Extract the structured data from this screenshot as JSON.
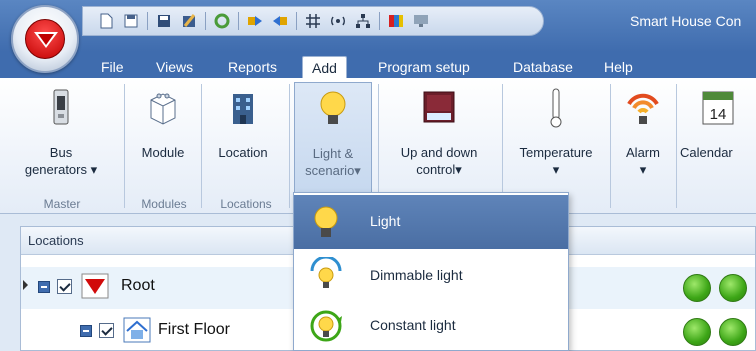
{
  "window": {
    "title": "Smart House Con",
    "quick_access_icons": [
      "new-icon",
      "save-icon",
      "save-as-icon",
      "edit-icon",
      "refresh-icon",
      "import-icon",
      "export-icon",
      "network-icon",
      "wireless-icon",
      "topology-icon",
      "palette-icon",
      "monitor-icon"
    ]
  },
  "menu": {
    "tabs": [
      "File",
      "Views",
      "Reports",
      "Add",
      "Program setup",
      "Database",
      "Help"
    ],
    "active": "Add"
  },
  "ribbon": {
    "buttons": [
      {
        "label_line1": "Bus",
        "label_line2": "generators",
        "has_dropdown": true,
        "icon": "bus-generator-icon"
      },
      {
        "label_line1": "Module",
        "label_line2": "",
        "has_dropdown": false,
        "icon": "module-icon"
      },
      {
        "label_line1": "Location",
        "label_line2": "",
        "has_dropdown": false,
        "icon": "building-icon"
      },
      {
        "label_line1": "Light &",
        "label_line2": "scenario",
        "has_dropdown": true,
        "icon": "light-bulb-icon"
      },
      {
        "label_line1": "Up and down",
        "label_line2": "control",
        "has_dropdown": true,
        "icon": "blind-icon"
      },
      {
        "label_line1": "Temperature",
        "label_line2": "",
        "has_dropdown": true,
        "icon": "thermometer-icon"
      },
      {
        "label_line1": "Alarm",
        "label_line2": "",
        "has_dropdown": true,
        "icon": "alarm-icon"
      },
      {
        "label_line1": "Calendar",
        "label_line2": "",
        "has_dropdown": false,
        "icon": "calendar-icon",
        "calendar_day": "14"
      }
    ],
    "groups": [
      "Master",
      "Modules",
      "Locations"
    ]
  },
  "dropdown": {
    "items": [
      {
        "label": "Light",
        "icon": "light-icon",
        "highlighted": true
      },
      {
        "label": "Dimmable light",
        "icon": "dimmable-light-icon",
        "highlighted": false
      },
      {
        "label": "Constant light",
        "icon": "constant-light-icon",
        "highlighted": false
      }
    ]
  },
  "locations_panel": {
    "header": "Locations",
    "rows": [
      {
        "label": "Root",
        "checked": true,
        "status": [
          "green",
          "green"
        ]
      },
      {
        "label": "First Floor",
        "checked": true,
        "status": [
          "green",
          "green"
        ]
      }
    ]
  },
  "colors": {
    "titlebar": "#3f6cae",
    "highlight": "#5f84b9",
    "status_ok": "#3da617"
  }
}
